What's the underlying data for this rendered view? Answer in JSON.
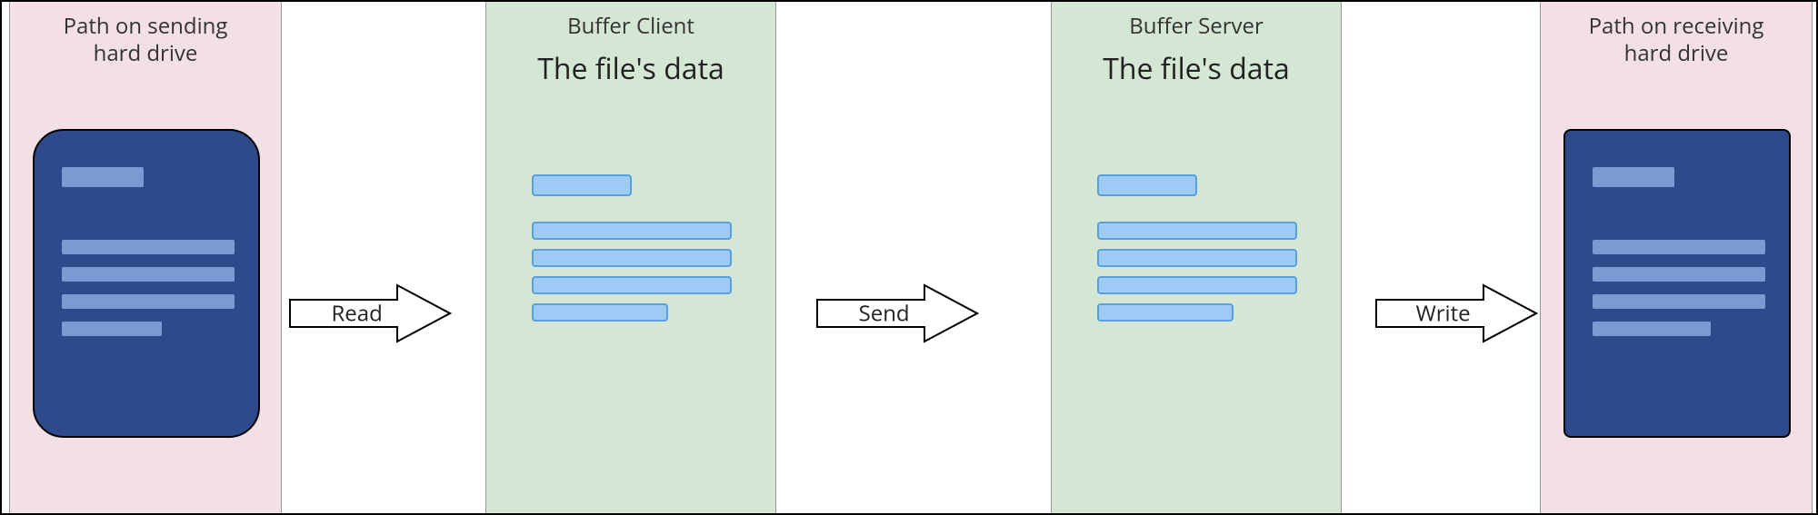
{
  "columns": {
    "sending_drive": {
      "title": "Path on sending\nhard drive"
    },
    "buffer_client": {
      "title": "Buffer Client",
      "subtitle": "The file's data"
    },
    "buffer_server": {
      "title": "Buffer Server",
      "subtitle": "The file's data"
    },
    "receiving_drive": {
      "title": "Path on receiving\nhard drive"
    }
  },
  "arrows": {
    "read": {
      "label": "Read"
    },
    "send": {
      "label": "Send"
    },
    "write": {
      "label": "Write"
    }
  },
  "colors": {
    "pink_bg": "#f3e0e4",
    "green_bg": "#d4e6d4",
    "file_fill": "#2f4a8a",
    "file_bar": "#7b9ad1",
    "data_line_fill": "#9ecbf5",
    "data_line_border": "#5a9de0"
  }
}
